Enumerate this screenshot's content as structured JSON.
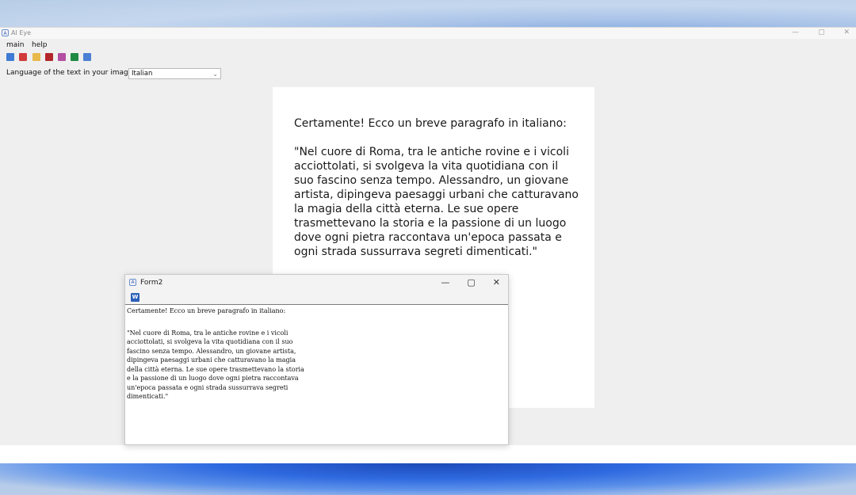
{
  "window": {
    "title": "AI Eye",
    "icon_text": "A",
    "minimize": "—",
    "maximize": "▢",
    "close": "✕"
  },
  "menu": {
    "items": [
      "main",
      "help"
    ]
  },
  "toolbar": {
    "icons": [
      {
        "name": "mail-icon",
        "color": "#3f7bd6"
      },
      {
        "name": "pdf-mail-icon",
        "color": "#d23b3b"
      },
      {
        "name": "folder-icon",
        "color": "#e8b84a"
      },
      {
        "name": "pdf-icon",
        "color": "#b3262a"
      },
      {
        "name": "print-icon",
        "color": "#b44ea3"
      },
      {
        "name": "excel-icon",
        "color": "#1e8a43"
      },
      {
        "name": "translate-icon",
        "color": "#4a7fd4"
      }
    ]
  },
  "language": {
    "label": "Language of the text in your image:",
    "selected": "Italian"
  },
  "preview": {
    "line1": "Certamente! Ecco un breve paragrafo in italiano:",
    "paragraph": "\"Nel cuore di Roma, tra le antiche rovine e i vicoli acciottolati, si svolgeva la vita quotidiana con il suo fascino senza tempo. Alessandro, un giovane artista, dipingeva paesaggi urbani che catturavano la magia della città eterna. Le sue opere trasmettevano la storia e la passione di un luogo dove ogni pietra raccontava un'epoca passata e ogni strada sussurrava segreti dimenticati.\""
  },
  "form2": {
    "title": "Form2",
    "icon_text": "A",
    "minimize": "—",
    "maximize": "▢",
    "close": "✕",
    "word_icon": "W",
    "text_line1": "Certamente! Ecco un breve paragrafo in italiano:",
    "text_lines": [
      "\"Nel cuore di Roma, tra le antiche rovine e i vicoli",
      "acciottolati, si svolgeva la vita quotidiana con il suo",
      "fascino senza tempo. Alessandro, un giovane artista,",
      "dipingeva paesaggi urbani che catturavano la magia",
      "della città eterna. Le sue opere trasmettevano la storia",
      "e la passione di un luogo dove ogni pietra raccontava",
      "un'epoca passata e ogni strada sussurrava segreti",
      "dimenticati.\""
    ]
  }
}
